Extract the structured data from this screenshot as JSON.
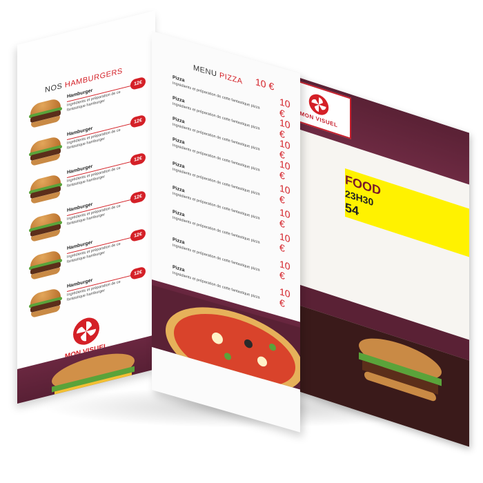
{
  "left": {
    "title_prefix": "NOS",
    "title_accent": "HAMBURGERS",
    "items": [
      {
        "name": "Hamburger",
        "desc": "Ingrédients et préparation de ce fantastique hamburger",
        "price": "12€"
      },
      {
        "name": "Hamburger",
        "desc": "Ingrédients et préparation de ce fantastique hamburger",
        "price": "12€"
      },
      {
        "name": "Hamburger",
        "desc": "Ingrédients et préparation de ce fantastique hamburger",
        "price": "12€"
      },
      {
        "name": "Hamburger",
        "desc": "Ingrédients et préparation de ce fantastique hamburger",
        "price": "12€"
      },
      {
        "name": "Hamburger",
        "desc": "Ingrédients et préparation de ce fantastique hamburger",
        "price": "12€"
      },
      {
        "name": "Hamburger",
        "desc": "Ingrédients et préparation de ce fantastique hamburger",
        "price": "12€"
      }
    ],
    "brand": "MON VISUEL"
  },
  "right": {
    "title_prefix": "MENU",
    "title_accent": "PIZZA",
    "items": [
      {
        "name": "Pizza",
        "desc": "Ingrédients et préparation de cette fantastique pizza",
        "price": "10 €"
      },
      {
        "name": "Pizza",
        "desc": "Ingrédients et préparation de cette fantastique pizza",
        "price": "10 €"
      },
      {
        "name": "Pizza",
        "desc": "Ingrédients et préparation de cette fantastique pizza",
        "price": "10 €"
      },
      {
        "name": "Pizza",
        "desc": "Ingrédients et préparation de cette fantastique pizza",
        "price": "10 €"
      },
      {
        "name": "Pizza",
        "desc": "Ingrédients et préparation de cette fantastique pizza",
        "price": "10 €"
      },
      {
        "name": "Pizza",
        "desc": "Ingrédients et préparation de cette fantastique pizza",
        "price": "10 €"
      },
      {
        "name": "Pizza",
        "desc": "Ingrédients et préparation de cette fantastique pizza",
        "price": "10 €"
      },
      {
        "name": "Pizza",
        "desc": "Ingrédients et préparation de cette fantastique pizza",
        "price": "10 €"
      },
      {
        "name": "Pizza",
        "desc": "Ingrédients et préparation de cette fantastique pizza",
        "price": "10 €"
      }
    ],
    "extra_prices": [
      "10 €",
      "10 €",
      "10 €"
    ]
  },
  "back": {
    "logo_text": "MON VISUEL",
    "banner_line1": "FOOD",
    "banner_line2": "23H30",
    "banner_line3": "54"
  },
  "colors": {
    "accent": "#d42027",
    "wine": "#5a2135",
    "banner": "#fff200"
  }
}
